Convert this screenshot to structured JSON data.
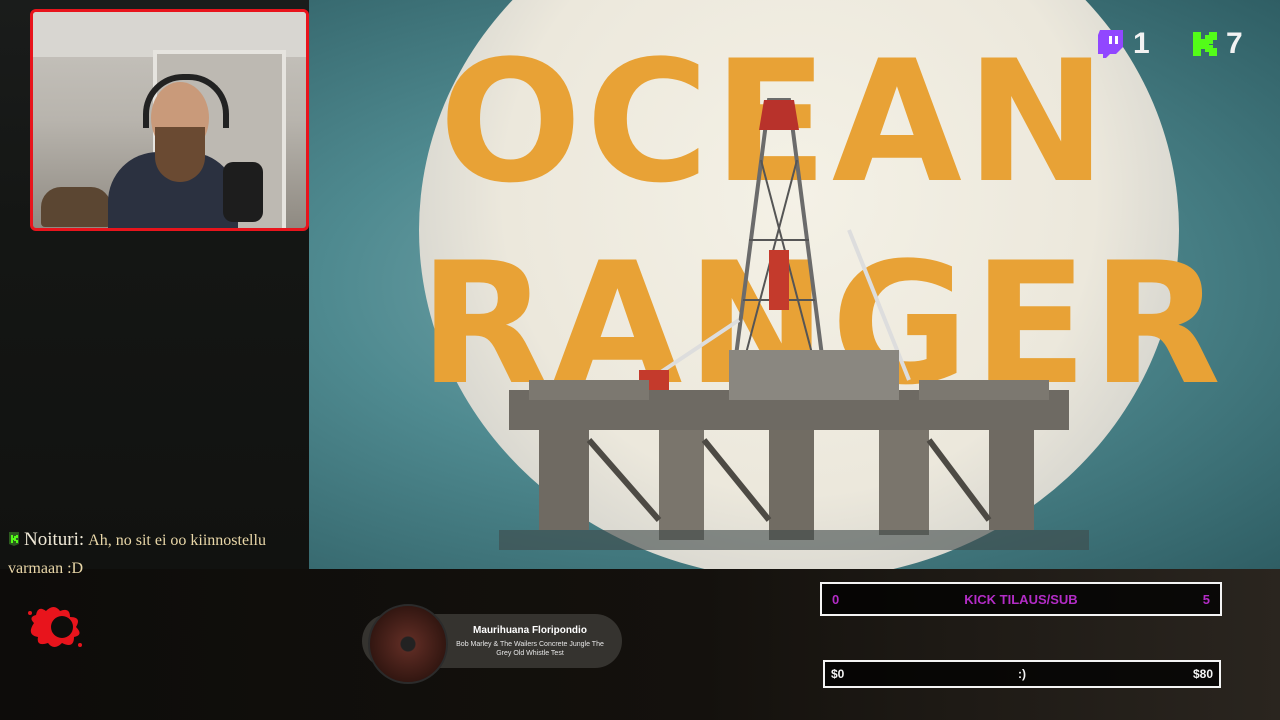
{
  "video": {
    "title_line1": "OCEAN",
    "title_line2": "RANGER"
  },
  "viewers": {
    "twitch_icon": "twitch-logo-icon",
    "twitch_count": "1",
    "kick_icon": "kick-logo-icon",
    "kick_count": "7",
    "twitch_color": "#9147ff",
    "kick_color": "#53fc18"
  },
  "chat": {
    "messages": [
      {
        "badge_icon": "kick-badge-icon",
        "author": "Noituri:",
        "text": "Ah, no sit ei oo kiinnostellu varmaan :D"
      }
    ]
  },
  "now_playing": {
    "title": "Maurihuana Floripondio",
    "subtitle": "Bob Marley & The Wailers Concrete Jungle The Grey Old Whistle Test"
  },
  "goals": {
    "kick_sub": {
      "start": "0",
      "label": "KICK TILAUS/SUB",
      "end": "5",
      "color": "#b32cc6"
    },
    "donation": {
      "start": "$0",
      "label": ":)",
      "end": "$80"
    }
  },
  "webcam": {
    "border_color": "#e8141c"
  },
  "logo": {
    "icon": "blood-splatter-icon",
    "color": "#e8141c"
  }
}
